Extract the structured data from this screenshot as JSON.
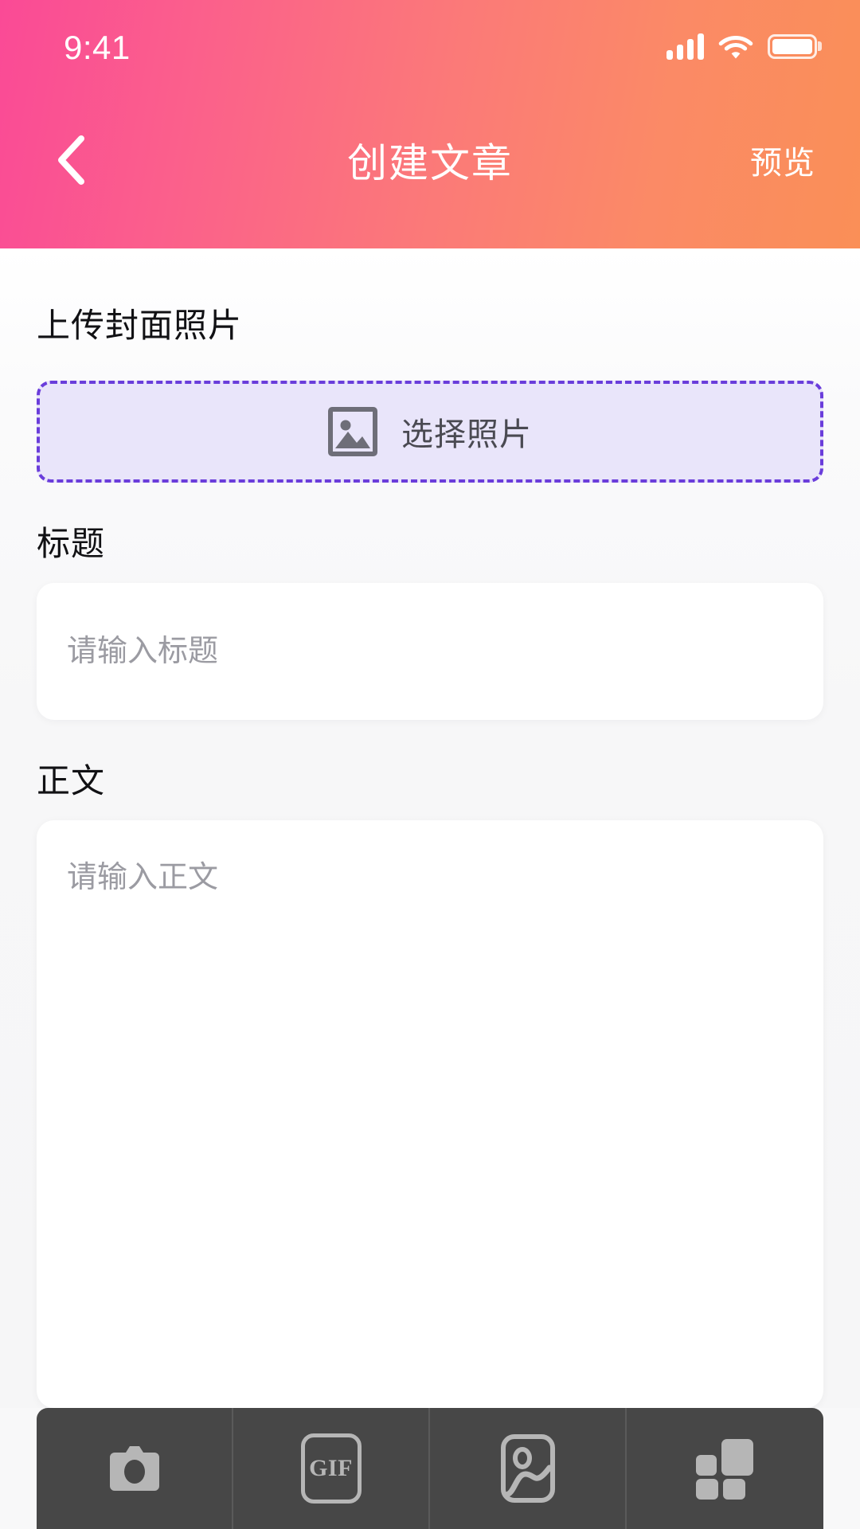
{
  "status_bar": {
    "time": "9:41",
    "signal_icon": "cellular-signal-icon",
    "signal_bars": 4,
    "wifi_icon": "wifi-icon",
    "battery_icon": "battery-full-icon",
    "battery_level": "100"
  },
  "nav": {
    "back_icon": "chevron-left-icon",
    "title": "创建文章",
    "action_label": "预览"
  },
  "cover": {
    "label": "上传封面照片",
    "picker_icon": "image-placeholder-icon",
    "picker_label": "选择照片"
  },
  "title_field": {
    "label": "标题",
    "placeholder": "请输入标题",
    "value": ""
  },
  "body_field": {
    "label": "正文",
    "placeholder": "请输入正文",
    "value": ""
  },
  "toolbar": {
    "items": [
      {
        "name": "camera",
        "icon": "camera-icon",
        "label": ""
      },
      {
        "name": "gif",
        "icon": "gif-icon",
        "label": "GIF"
      },
      {
        "name": "image",
        "icon": "photo-icon",
        "label": ""
      },
      {
        "name": "widgets",
        "icon": "blocks-grid-icon",
        "label": ""
      }
    ]
  },
  "colors": {
    "gradient_start": "#fa4a96",
    "gradient_end": "#fa8f57",
    "accent_purple": "#6a3ddb",
    "picker_bg": "#e9e5fa",
    "toolbar_bg": "#474747",
    "page_bg": "#f7f7f8"
  }
}
